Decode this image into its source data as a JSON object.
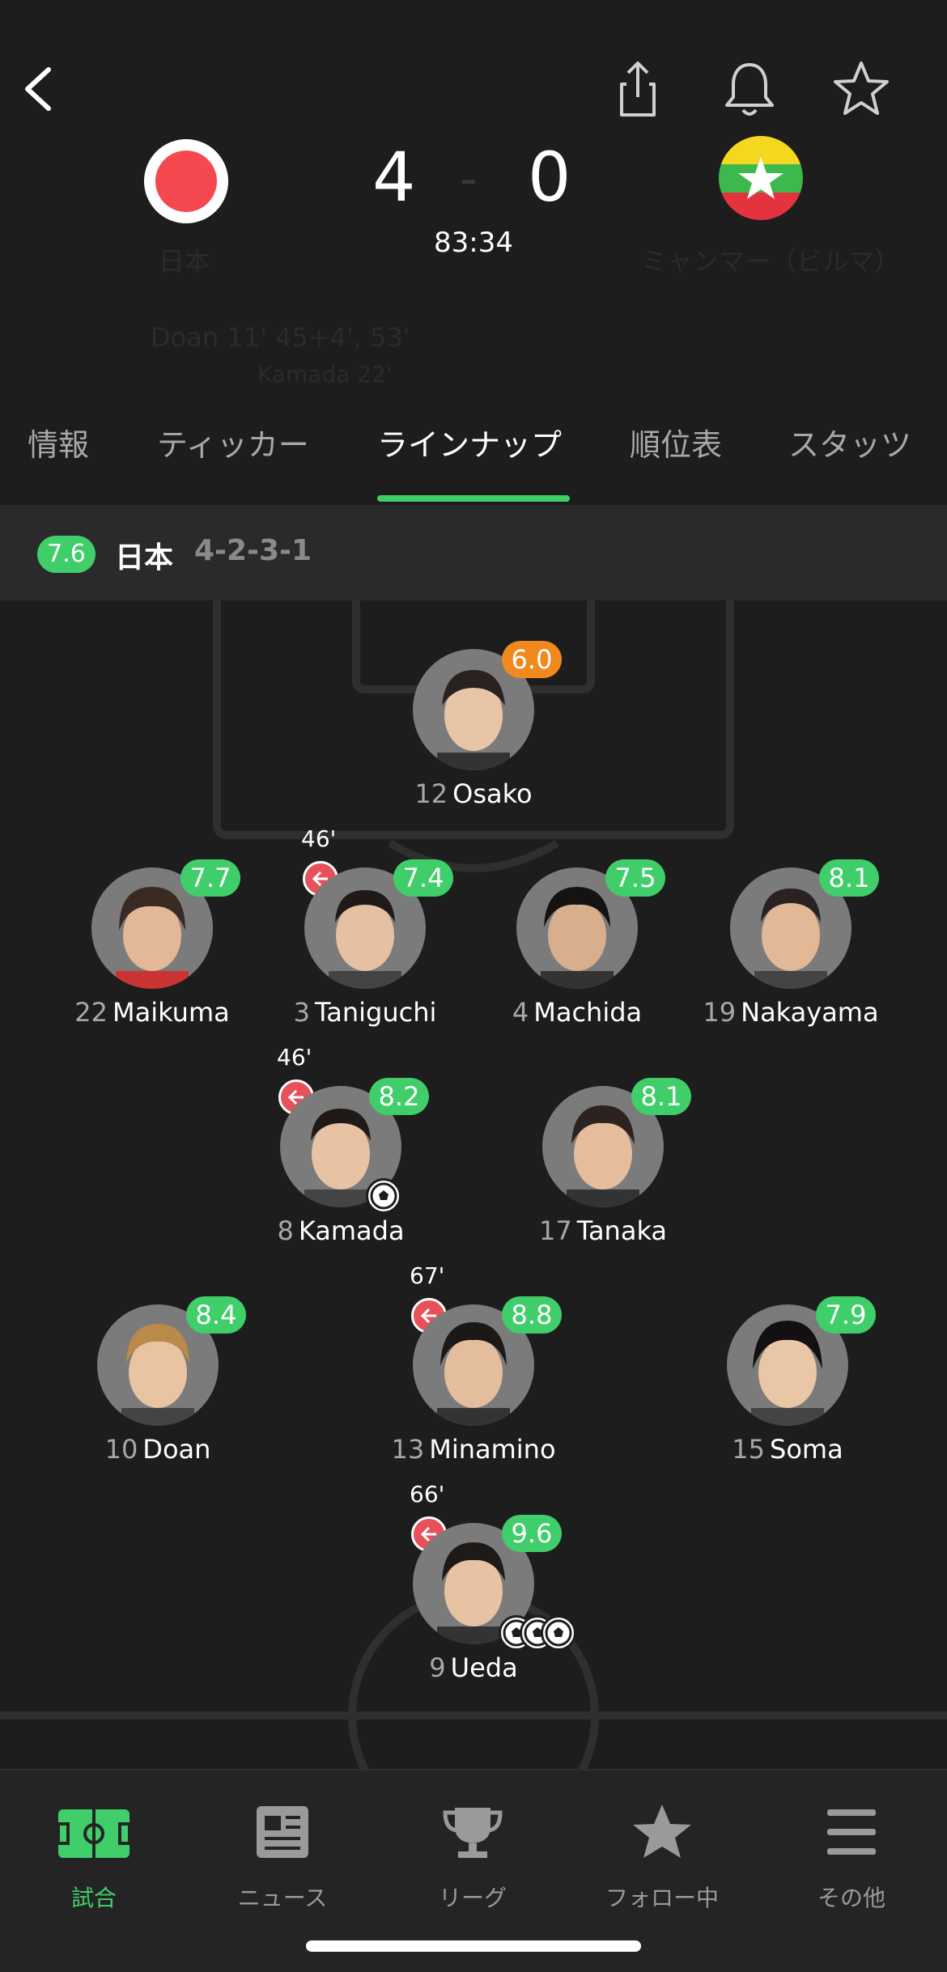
{
  "match": {
    "home_team": "日本",
    "away_team": "ミャンマー（ビルマ）",
    "home_score": "4",
    "away_score": "0",
    "separator": "-",
    "clock": "83:34",
    "scorers_line": "Doan 11' 45+4', 53'",
    "scorers_line2": "Kamada 22'",
    "colors": {
      "accent": "#3fce6a",
      "orange": "#f08a1e",
      "sub_red": "#e8505a"
    }
  },
  "tabs": [
    {
      "label": "情報"
    },
    {
      "label": "ティッカー"
    },
    {
      "label": "ラインナップ"
    },
    {
      "label": "順位表"
    },
    {
      "label": "スタッツ"
    }
  ],
  "lineup": {
    "team_rating": "7.6",
    "team_name": "日本",
    "formation": "4-2-3-1",
    "players": [
      {
        "number": "12",
        "name": "Osako",
        "rating": "6.0",
        "rating_color": "orange"
      },
      {
        "number": "22",
        "name": "Maikuma",
        "rating": "7.7"
      },
      {
        "number": "3",
        "name": "Taniguchi",
        "rating": "7.4",
        "sub_time": "46'"
      },
      {
        "number": "4",
        "name": "Machida",
        "rating": "7.5"
      },
      {
        "number": "19",
        "name": "Nakayama",
        "rating": "8.1"
      },
      {
        "number": "8",
        "name": "Kamada",
        "rating": "8.2",
        "sub_time": "46'"
      },
      {
        "number": "17",
        "name": "Tanaka",
        "rating": "8.1"
      },
      {
        "number": "10",
        "name": "Doan",
        "rating": "8.4"
      },
      {
        "number": "13",
        "name": "Minamino",
        "rating": "8.8",
        "sub_time": "67'"
      },
      {
        "number": "15",
        "name": "Soma",
        "rating": "7.9"
      },
      {
        "number": "9",
        "name": "Ueda",
        "rating": "9.6",
        "sub_time": "66'"
      }
    ]
  },
  "bottom_nav": [
    {
      "label": "試合",
      "icon": "pitch-icon"
    },
    {
      "label": "ニュース",
      "icon": "news-icon"
    },
    {
      "label": "リーグ",
      "icon": "trophy-icon"
    },
    {
      "label": "フォロー中",
      "icon": "star-icon"
    },
    {
      "label": "その他",
      "icon": "menu-icon"
    }
  ]
}
